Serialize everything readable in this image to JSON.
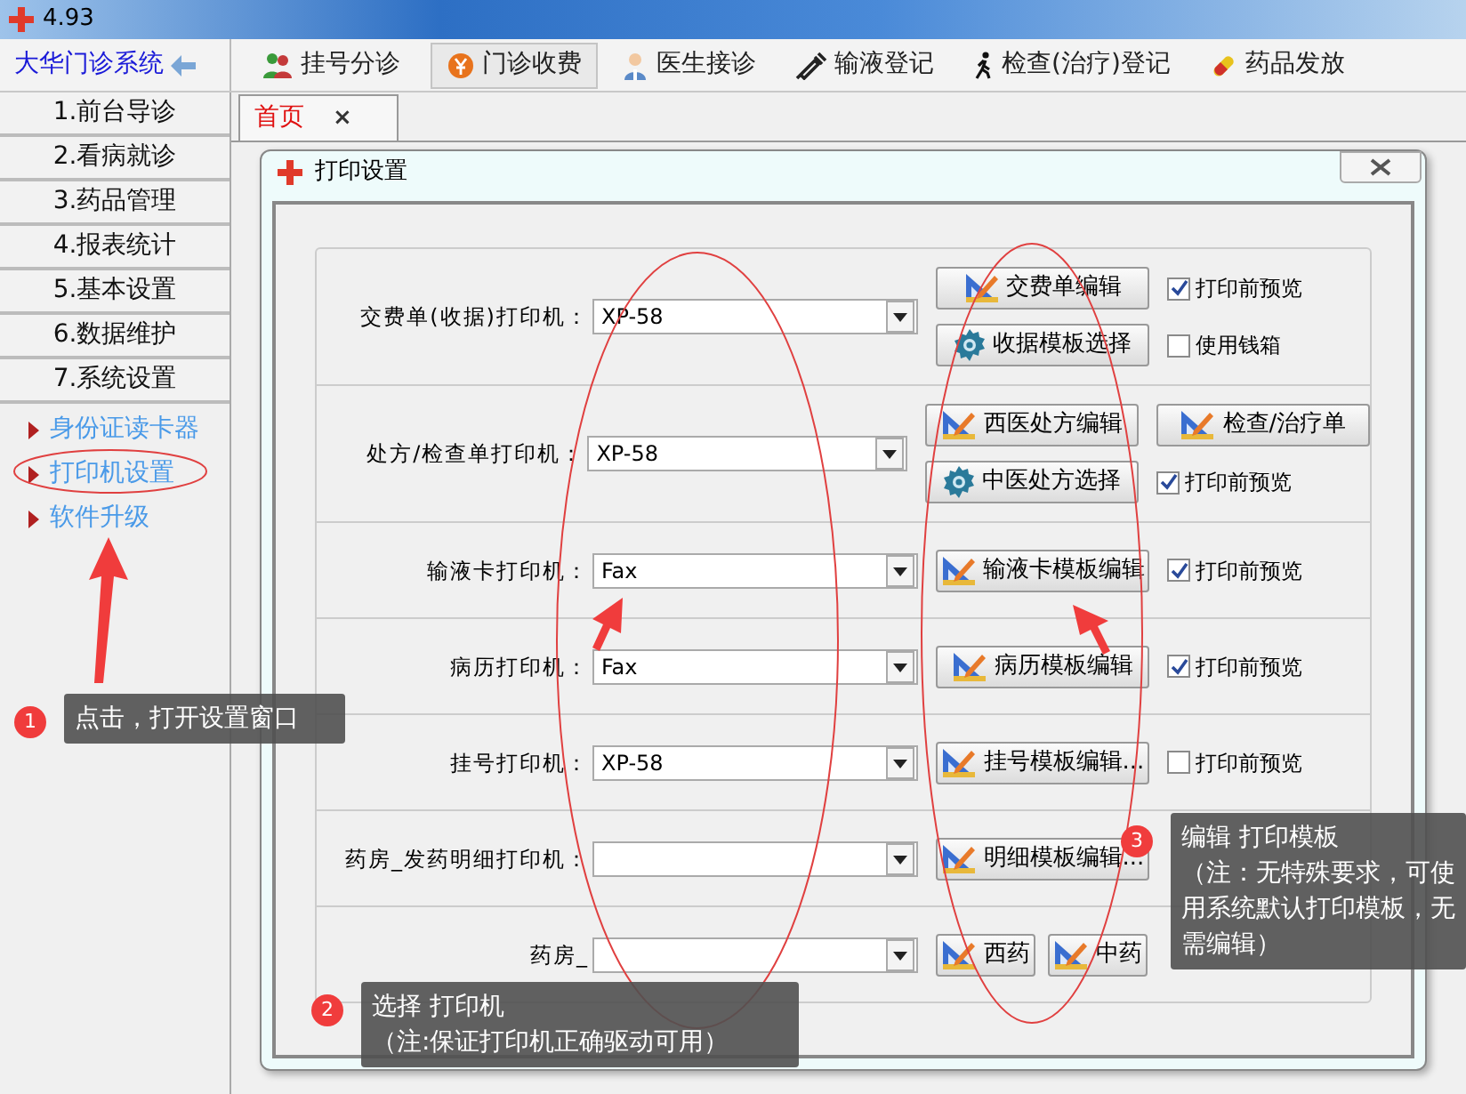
{
  "window": {
    "title": "4.93"
  },
  "app": {
    "name": "大华门诊系统"
  },
  "modules": [
    {
      "label": "挂号分诊",
      "selected": false
    },
    {
      "label": "门诊收费",
      "selected": true
    },
    {
      "label": "医生接诊",
      "selected": false
    },
    {
      "label": "输液登记",
      "selected": false
    },
    {
      "label": "检查(治疗)登记",
      "selected": false
    },
    {
      "label": "药品发放",
      "selected": false
    }
  ],
  "sidebar": {
    "menu": [
      "1.前台导诊",
      "2.看病就诊",
      "3.药品管理",
      "4.报表统计",
      "5.基本设置",
      "6.数据维护",
      "7.系统设置"
    ],
    "links": [
      "身份证读卡器",
      "打印机设置",
      "软件升级"
    ]
  },
  "page_tabs": [
    {
      "label": "首页",
      "close": "×",
      "selected": true
    }
  ],
  "dialog": {
    "title": "打印设置",
    "rows": [
      {
        "label": "交费单(收据)打印机：",
        "value": "XP-58",
        "lines": [
          [
            {
              "kind": "edit",
              "label": "交费单编辑"
            },
            {
              "kind": "checkbox",
              "label": "打印前预览",
              "checked": true
            }
          ],
          [
            {
              "kind": "gear",
              "label": "收据模板选择"
            },
            {
              "kind": "checkbox",
              "label": "使用钱箱",
              "checked": false
            }
          ]
        ]
      },
      {
        "label": "处方/检查单打印机：",
        "value": "XP-58",
        "lines": [
          [
            {
              "kind": "edit",
              "label": "西医处方编辑"
            },
            {
              "kind": "edit",
              "label": "检查/治疗单"
            }
          ],
          [
            {
              "kind": "gear",
              "label": "中医处方选择"
            },
            {
              "kind": "checkbox",
              "label": "打印前预览",
              "checked": true
            }
          ]
        ]
      },
      {
        "label": "输液卡打印机：",
        "value": "Fax",
        "lines": [
          [
            {
              "kind": "edit",
              "label": "输液卡模板编辑"
            },
            {
              "kind": "checkbox",
              "label": "打印前预览",
              "checked": true
            }
          ]
        ]
      },
      {
        "label": "病历打印机：",
        "value": "Fax",
        "lines": [
          [
            {
              "kind": "edit",
              "label": "病历模板编辑"
            },
            {
              "kind": "checkbox",
              "label": "打印前预览",
              "checked": true
            }
          ]
        ]
      },
      {
        "label": "挂号打印机：",
        "value": "XP-58",
        "lines": [
          [
            {
              "kind": "edit",
              "label": "挂号模板编辑..."
            },
            {
              "kind": "checkbox",
              "label": "打印前预览",
              "checked": false
            }
          ]
        ]
      },
      {
        "label": "药房_发药明细打印机：",
        "value": "",
        "lines": [
          [
            {
              "kind": "edit",
              "label": "明细模板编辑..."
            }
          ]
        ]
      },
      {
        "label": "药房_",
        "value": "",
        "lines": [
          [
            {
              "kind": "small",
              "label": "西药"
            },
            {
              "kind": "small",
              "label": "中药"
            }
          ]
        ]
      }
    ]
  },
  "callouts": [
    {
      "number": "1",
      "lines": [
        "点击，打开设置窗口"
      ]
    },
    {
      "number": "2",
      "lines": [
        "选择 打印机",
        "（注:保证打印机正确驱动可用）"
      ]
    },
    {
      "number": "3",
      "lines": [
        "编辑 打印模板",
        "（注：无特殊要求，可使用系统默认打印模板，无需编辑）"
      ]
    }
  ]
}
